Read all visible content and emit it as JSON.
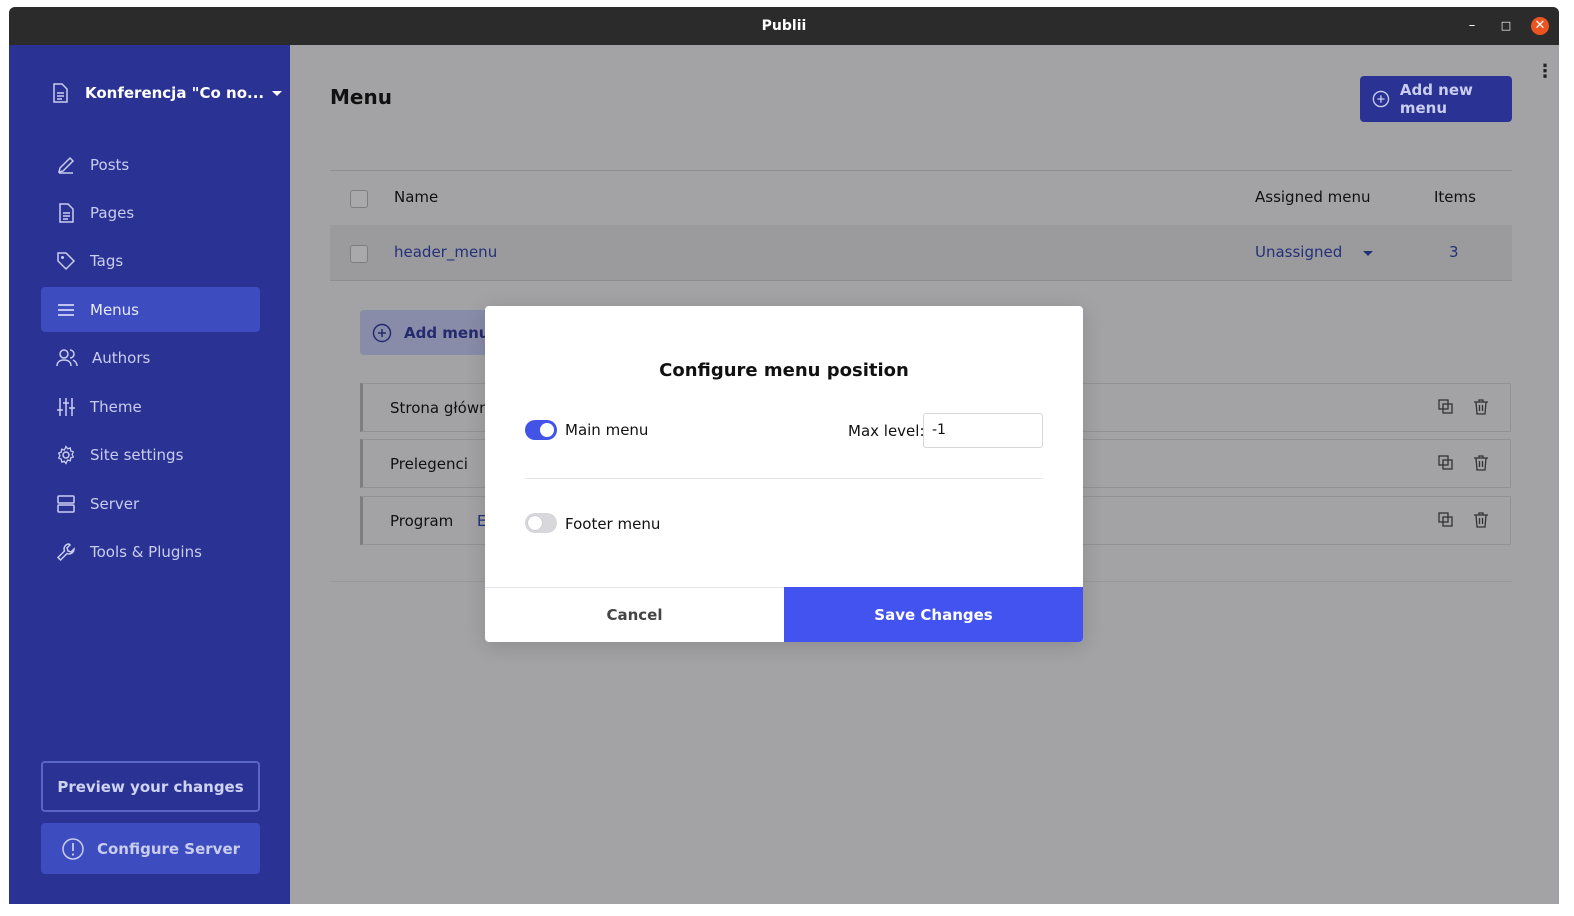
{
  "window": {
    "title": "Publii",
    "minimize": "–",
    "maximize": "□",
    "close": "✕"
  },
  "sidebar": {
    "site_name": "Konferencja \"Co no...",
    "items": [
      {
        "label": "Posts",
        "icon": "pencil-icon"
      },
      {
        "label": "Pages",
        "icon": "page-icon"
      },
      {
        "label": "Tags",
        "icon": "tag-icon"
      },
      {
        "label": "Menus",
        "icon": "menu-icon",
        "active": true
      },
      {
        "label": "Authors",
        "icon": "users-icon"
      },
      {
        "label": "Theme",
        "icon": "sliders-icon"
      },
      {
        "label": "Site settings",
        "icon": "gear-icon"
      },
      {
        "label": "Server",
        "icon": "server-icon"
      },
      {
        "label": "Tools & Plugins",
        "icon": "wrench-icon"
      }
    ],
    "preview_label": "Preview your changes",
    "configure_label": "Configure Server"
  },
  "main": {
    "title": "Menu",
    "add_new_menu": "Add new menu",
    "table": {
      "headers": {
        "name": "Name",
        "assigned": "Assigned menu",
        "items": "Items"
      },
      "rows": [
        {
          "name": "header_menu",
          "assigned": "Unassigned",
          "items": "3"
        }
      ]
    },
    "add_menu_item": "Add menu item",
    "menu_items": [
      {
        "label": "Strona główna",
        "extra": ""
      },
      {
        "label": "Prelegenci",
        "extra": ""
      },
      {
        "label": "Program",
        "extra": "E"
      }
    ]
  },
  "modal": {
    "title": "Configure menu position",
    "positions": [
      {
        "label": "Main menu",
        "enabled": true
      },
      {
        "label": "Footer menu",
        "enabled": false
      }
    ],
    "max_level_label": "Max level:",
    "max_level_value": "-1",
    "cancel_label": "Cancel",
    "save_label": "Save Changes"
  },
  "colors": {
    "sidebar": "#2a3394",
    "accent": "#4353f0",
    "overlay": "#a3a3a5"
  }
}
